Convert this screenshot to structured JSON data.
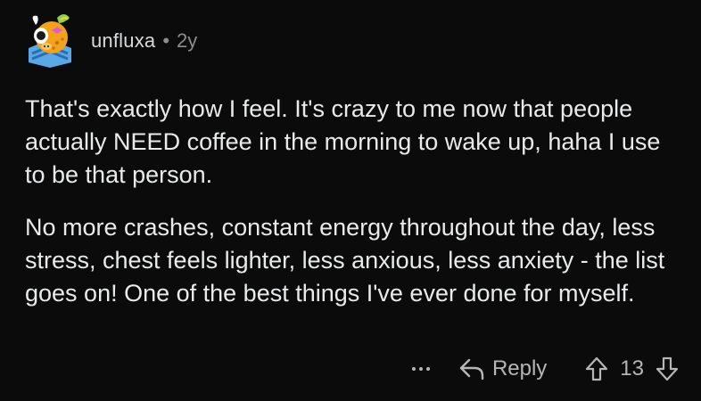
{
  "comment": {
    "author": "unfluxa",
    "separator": "•",
    "age": "2y",
    "paragraphs": [
      "That's exactly how I feel. It's crazy to me now that people actually NEED coffee in the morning to wake up, haha I use to be that person.",
      "No more crashes, constant energy throughout the day, less stress, chest feels lighter, less anxious, less anxiety - the list goes on! One of the best things I've ever done for myself."
    ],
    "actions": {
      "reply_label": "Reply",
      "vote_count": "13"
    }
  },
  "icons": {
    "more": "more-horizontal-icon",
    "reply": "reply-arrow-icon",
    "upvote": "upvote-arrow-icon",
    "downvote": "downvote-arrow-icon"
  },
  "colors": {
    "background": "#0b0b0b",
    "text": "#e8eaeb",
    "meta": "#8a8d8f",
    "action": "#b4b6b8"
  }
}
